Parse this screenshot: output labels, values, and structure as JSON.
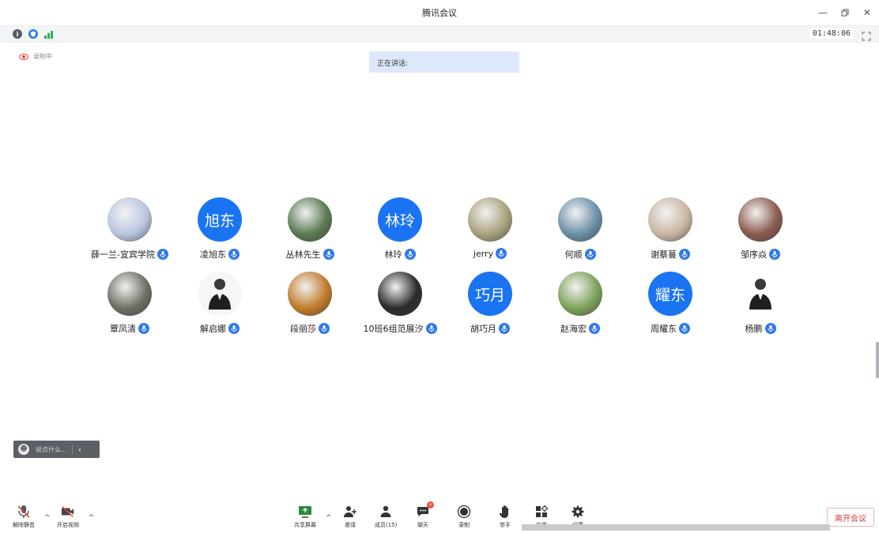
{
  "window": {
    "title": "腾讯会议"
  },
  "infobar": {
    "timer": "01:48:06"
  },
  "recording": {
    "label": "录制中"
  },
  "speaking": {
    "label": "正在讲话:"
  },
  "participants": [
    {
      "name": "薛一兰-宜宾学院",
      "avatar_text": "",
      "avatar_color": "#b9c6e0"
    },
    {
      "name": "凌旭东",
      "avatar_text": "旭东",
      "avatar_color": "#1a74f2"
    },
    {
      "name": "丛林先生",
      "avatar_text": "",
      "avatar_color": "#5b7a53"
    },
    {
      "name": "林玲",
      "avatar_text": "林玲",
      "avatar_color": "#1a74f2"
    },
    {
      "name": "jerry",
      "avatar_text": "",
      "avatar_color": "#a9a17e"
    },
    {
      "name": "何顺",
      "avatar_text": "",
      "avatar_color": "#6b8fa8"
    },
    {
      "name": "谢蔡蔓",
      "avatar_text": "",
      "avatar_color": "#c9b6a3"
    },
    {
      "name": "邹序焱",
      "avatar_text": "",
      "avatar_color": "#8a5b4f"
    },
    {
      "name": "覃凤清",
      "avatar_text": "",
      "avatar_color": "#6e6e63"
    },
    {
      "name": "解启娜",
      "avatar_text": "",
      "avatar_color": "#f6f6f6"
    },
    {
      "name": "段丽莎",
      "avatar_text": "",
      "avatar_color": "#c07a2a"
    },
    {
      "name": "10班6组范展汐",
      "avatar_text": "",
      "avatar_color": "#2b2b2b"
    },
    {
      "name": "胡巧月",
      "avatar_text": "巧月",
      "avatar_color": "#1a74f2"
    },
    {
      "name": "赵海宏",
      "avatar_text": "",
      "avatar_color": "#7da25a"
    },
    {
      "name": "周耀东",
      "avatar_text": "耀东",
      "avatar_color": "#1a74f2"
    },
    {
      "name": "杨鹏",
      "avatar_text": "",
      "avatar_color": "#ffffff"
    }
  ],
  "chat": {
    "placeholder": "说点什么..."
  },
  "toolbar": {
    "unmute": "解除静音",
    "start_video": "开启视频",
    "share_screen": "共享屏幕",
    "invite": "邀请",
    "members": "成员(15)",
    "chat": "聊天",
    "record": "录制",
    "raise_hand": "举手",
    "apps": "应用",
    "settings": "设置",
    "leave": "离开会议"
  },
  "colors": {
    "accent": "#1a74f2",
    "leave": "#d83b3b"
  }
}
